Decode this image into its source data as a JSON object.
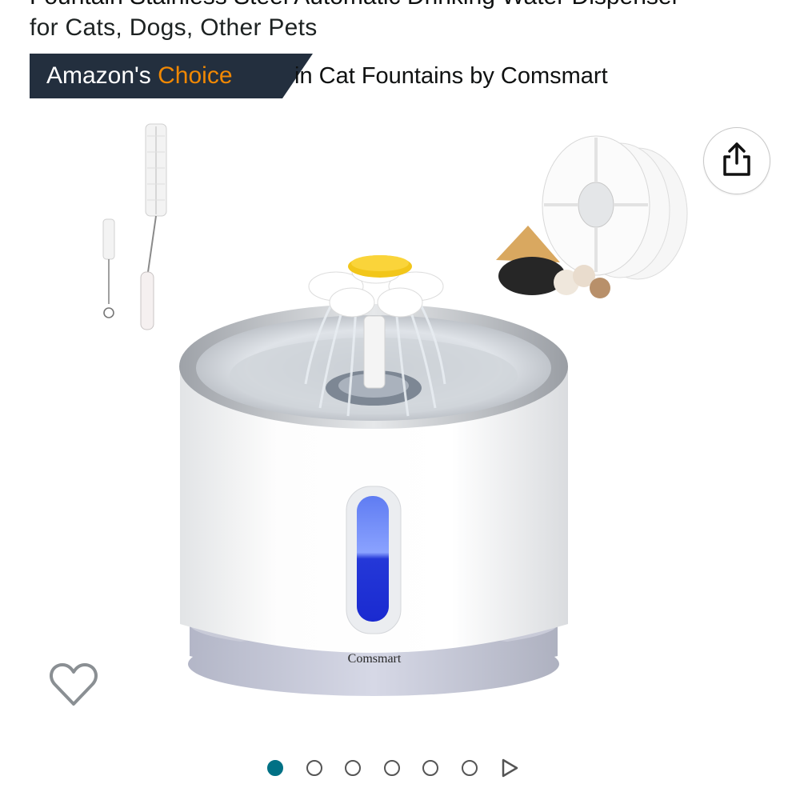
{
  "product": {
    "title_line1": "Fountain Stainless Steel Automatic Drinking Water Dispenser",
    "title_line2": "for Cats, Dogs, Other Pets"
  },
  "badge": {
    "prefix": "Amazon's",
    "highlight": "Choice",
    "context": "in Cat Fountains by Comsmart"
  },
  "image": {
    "brand_mark": "Comsmart"
  },
  "actions": {
    "share_icon": "share-icon",
    "wishlist_icon": "heart-outline-icon"
  },
  "carousel": {
    "total_dots": 6,
    "active_index": 0,
    "next_icon": "play-triangle-icon"
  },
  "colors": {
    "badge_bg": "#232f3e",
    "choice_text": "#f08804",
    "active_dot": "#007185"
  }
}
